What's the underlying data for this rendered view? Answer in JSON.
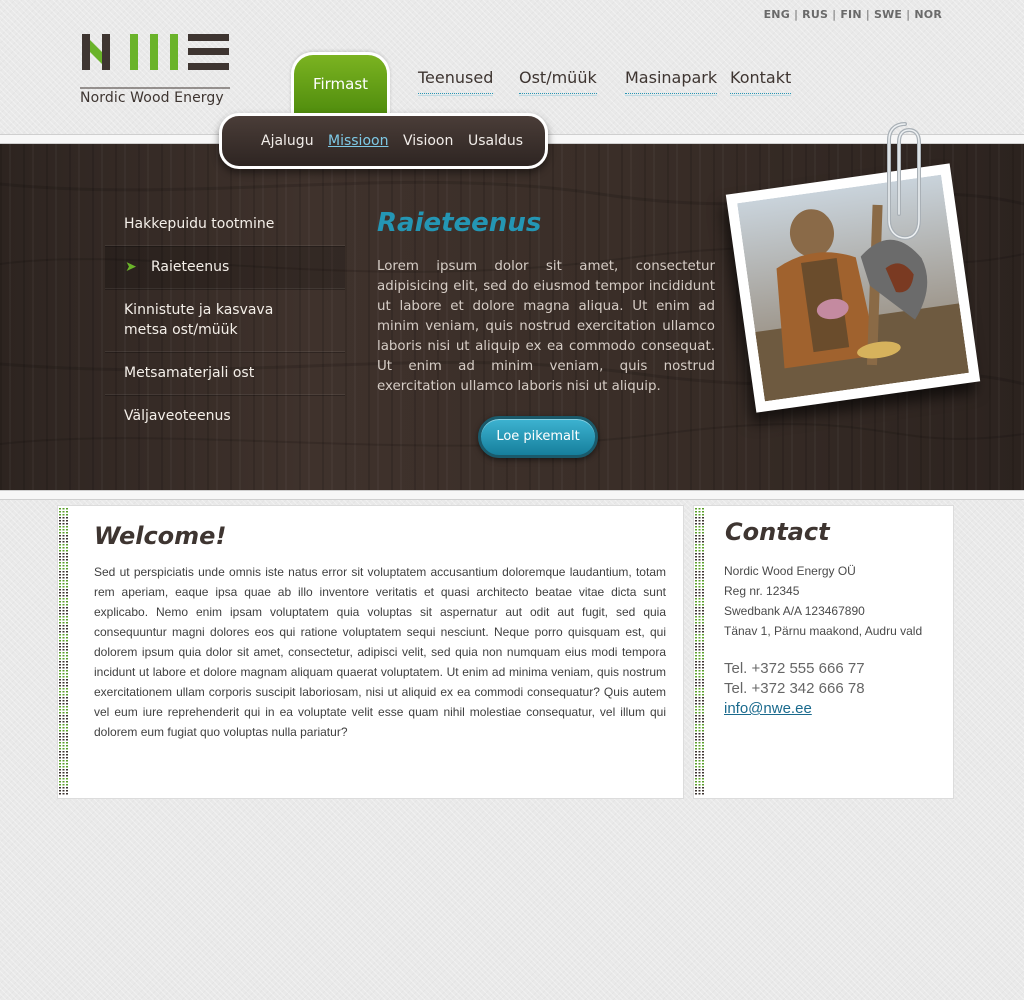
{
  "languages": [
    "ENG",
    "RUS",
    "FIN",
    "SWE",
    "NOR"
  ],
  "logo": {
    "text": "Nordic Wood Energy",
    "green": "#6ab32a",
    "dark": "#3e3531"
  },
  "main_nav": {
    "active": "Firmast",
    "items": [
      "Teenused",
      "Ost/müük",
      "Masinapark",
      "Kontakt"
    ]
  },
  "sub_nav": {
    "items": [
      "Ajalugu",
      "Missioon",
      "Visioon",
      "Usaldus"
    ],
    "active": "Missioon"
  },
  "side_menu": {
    "items": [
      "Hakkepuidu tootmine",
      "Raieteenus",
      "Kinnistute ja kasvava\nmetsa ost/müük",
      "Metsamaterjali ost",
      "Väljaveoteenus"
    ],
    "active_arrow": "➤"
  },
  "feature": {
    "title": "Raieteenus",
    "text": "Lorem ipsum dolor sit amet, consectetur adipisicing elit, sed do eiusmod tempor incididunt ut labore et dolore magna aliqua. Ut enim ad minim veniam, quis nostrud exercitation ullamco laboris nisi ut aliquip ex ea commodo consequat.  Ut enim ad minim veniam, quis nostrud exercitation ullamco laboris nisi ut aliquip.",
    "button": "Loe pikemalt"
  },
  "welcome": {
    "title": "Welcome!",
    "text": "Sed ut perspiciatis unde omnis iste natus error sit voluptatem accusantium doloremque laudantium, totam rem aperiam, eaque ipsa quae ab illo inventore veritatis et quasi architecto beatae vitae dicta sunt explicabo. Nemo enim ipsam voluptatem quia voluptas sit aspernatur aut odit aut fugit, sed quia consequuntur magni dolores eos qui ratione voluptatem sequi nesciunt. Neque porro quisquam est, qui dolorem ipsum quia dolor sit amet, consectetur, adipisci velit, sed quia non numquam eius modi tempora incidunt ut labore et dolore magnam aliquam quaerat voluptatem. Ut enim ad minima veniam, quis nostrum exercitationem ullam corporis suscipit laboriosam, nisi ut aliquid ex ea commodi consequatur? Quis autem vel eum iure reprehenderit qui in ea voluptate velit esse quam nihil molestiae consequatur, vel illum qui dolorem eum fugiat quo voluptas nulla pariatur?"
  },
  "contact": {
    "title": "Contact",
    "company": "Nordic Wood Energy OÜ",
    "reg": "Reg nr. 12345",
    "bank": "Swedbank A/A 123467890",
    "address": "Tänav 1, Pärnu maakond, Audru vald",
    "phone1": "Tel. +372 555 666 77",
    "phone2": "Tel. +372 342 666 78",
    "email": "info@nwe.ee"
  },
  "colors": {
    "accent_blue": "#2496b4",
    "brand_green": "#6ab32a",
    "wood_dark": "#3a2e29"
  }
}
